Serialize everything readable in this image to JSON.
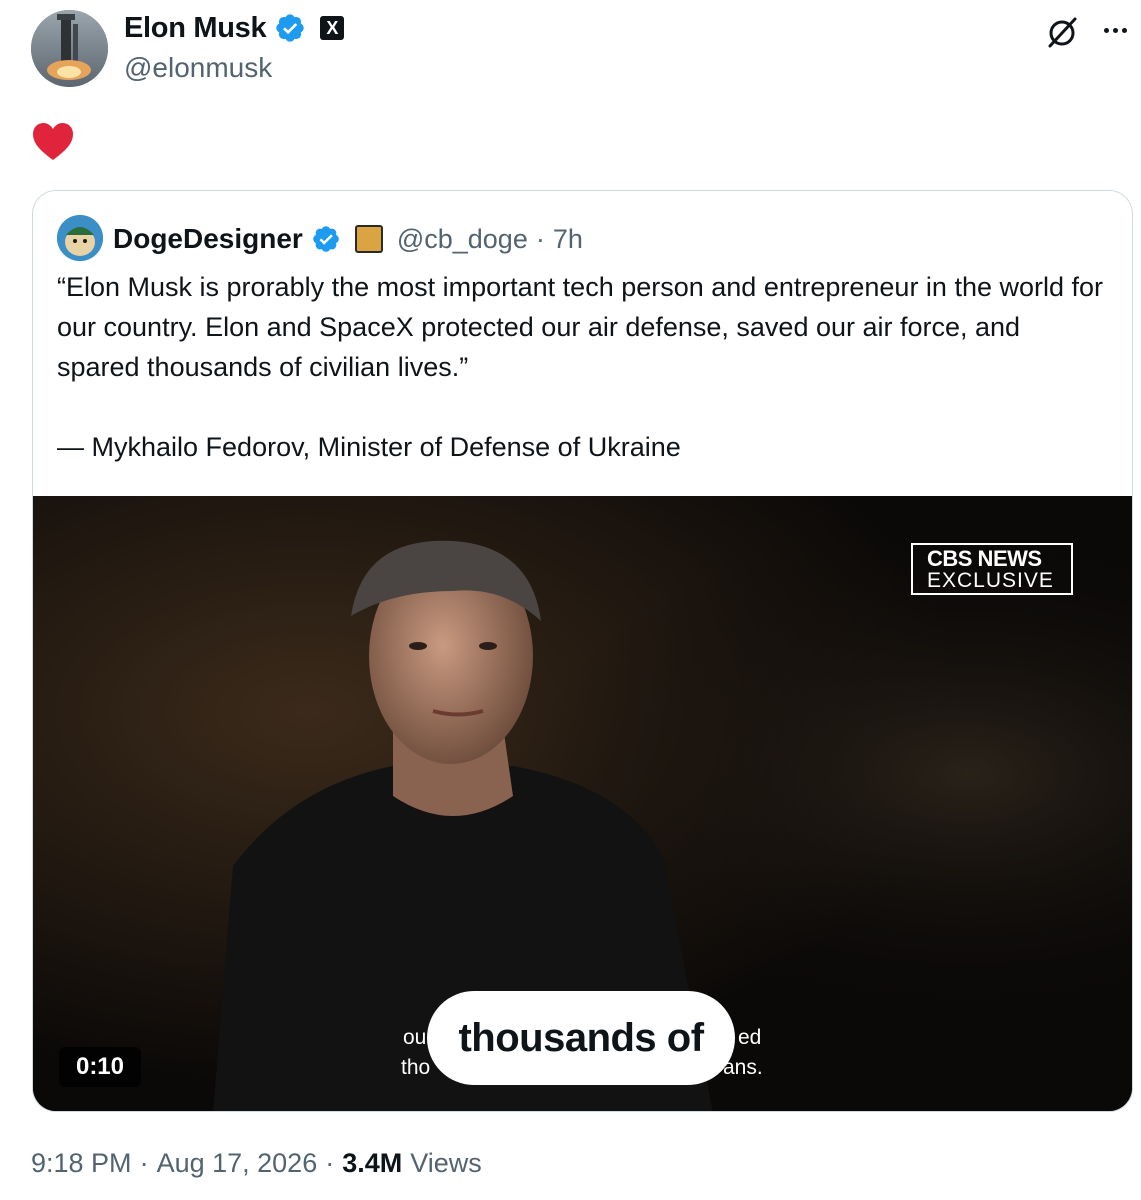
{
  "author": {
    "display_name": "Elon Musk",
    "handle": "@elonmusk",
    "verified_icon": "verified-badge-icon",
    "affiliate_badge_letter": "X"
  },
  "post": {
    "body_emoji": "heart-emoji"
  },
  "quoted": {
    "display_name": "DogeDesigner",
    "handle": "@cb_doge",
    "separator": "·",
    "time": "7h",
    "text": "“Elon Musk is prorably the most important tech person and entrepreneur in the world for our country. Elon and SpaceX protected our air defense, saved our air force, and spared thousands of civilian lives.”",
    "attribution": "— Mykhailo Fedorov, Minister of Defense of Ukraine",
    "video": {
      "logo_line1": "CBS NEWS",
      "logo_line2": "EXCLUSIVE",
      "caption": "thousands of",
      "sub_left_top": "ou",
      "sub_left_bottom": "tho",
      "sub_right_top": "ed",
      "sub_right_bottom": "ans.",
      "duration": "0:10"
    }
  },
  "footer": {
    "time": "9:18 PM",
    "sep1": "·",
    "date": "Aug 17, 2026",
    "sep2": "·",
    "views_count": "3.4M",
    "views_label": "Views"
  },
  "colors": {
    "accent_blue": "#1d9bf0",
    "secondary_text": "#536471",
    "border": "#cfd9de",
    "heart": "#f91880"
  }
}
